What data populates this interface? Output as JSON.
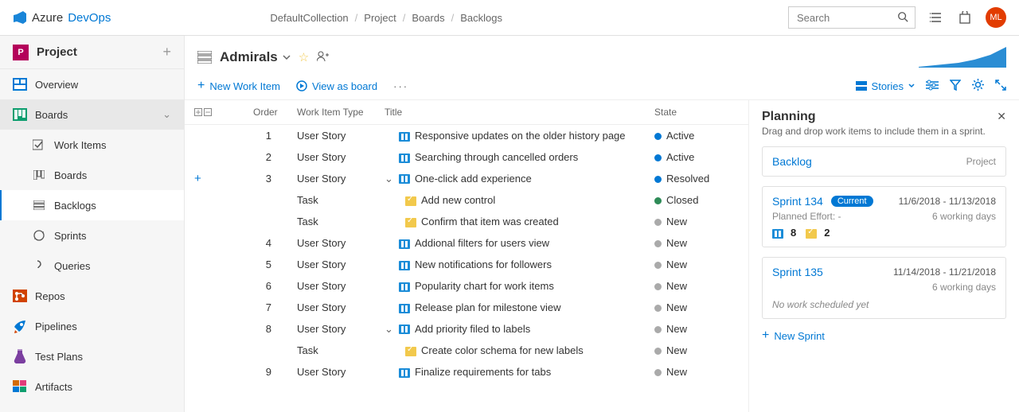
{
  "brand": {
    "azure": "Azure",
    "devops": "DevOps"
  },
  "breadcrumb": [
    "DefaultCollection",
    "Project",
    "Boards",
    "Backlogs"
  ],
  "search": {
    "placeholder": "Search"
  },
  "avatar": "ML",
  "project": {
    "initial": "P",
    "name": "Project"
  },
  "sidebar": [
    {
      "icon": "overview",
      "label": "Overview"
    },
    {
      "icon": "boards",
      "label": "Boards",
      "expanded": true,
      "children": [
        {
          "label": "Work Items"
        },
        {
          "label": "Boards"
        },
        {
          "label": "Backlogs",
          "active": true
        },
        {
          "label": "Sprints"
        },
        {
          "label": "Queries"
        }
      ]
    },
    {
      "icon": "repos",
      "label": "Repos"
    },
    {
      "icon": "pipelines",
      "label": "Pipelines"
    },
    {
      "icon": "testplans",
      "label": "Test Plans"
    },
    {
      "icon": "artifacts",
      "label": "Artifacts"
    }
  ],
  "team": {
    "icon": "backlog",
    "name": "Admirals"
  },
  "toolbar": {
    "newWorkItem": "New Work Item",
    "viewAsBoard": "View as board",
    "stories": "Stories"
  },
  "columns": {
    "order": "Order",
    "type": "Work Item Type",
    "title": "Title",
    "state": "State"
  },
  "rows": [
    {
      "order": "1",
      "type": "User Story",
      "icon": "story",
      "title": "Responsive updates on the older history page",
      "state": "Active",
      "stateClass": "active"
    },
    {
      "order": "2",
      "type": "User Story",
      "icon": "story",
      "title": "Searching through cancelled orders",
      "state": "Active",
      "stateClass": "active"
    },
    {
      "order": "3",
      "type": "User Story",
      "icon": "story",
      "title": "One-click add experience",
      "state": "Resolved",
      "stateClass": "resolved",
      "expander": "v",
      "addPlus": true
    },
    {
      "order": "",
      "type": "Task",
      "icon": "task",
      "title": "Add new control",
      "state": "Closed",
      "stateClass": "closed",
      "indent": 1
    },
    {
      "order": "",
      "type": "Task",
      "icon": "task",
      "title": "Confirm that item was created",
      "state": "New",
      "stateClass": "new",
      "indent": 1
    },
    {
      "order": "4",
      "type": "User Story",
      "icon": "story",
      "title": "Addional filters for users view",
      "state": "New",
      "stateClass": "new"
    },
    {
      "order": "5",
      "type": "User Story",
      "icon": "story",
      "title": "New notifications for followers",
      "state": "New",
      "stateClass": "new"
    },
    {
      "order": "6",
      "type": "User Story",
      "icon": "story",
      "title": "Popularity chart for work items",
      "state": "New",
      "stateClass": "new"
    },
    {
      "order": "7",
      "type": "User Story",
      "icon": "story",
      "title": "Release plan for milestone view",
      "state": "New",
      "stateClass": "new"
    },
    {
      "order": "8",
      "type": "User Story",
      "icon": "story",
      "title": "Add priority filed to labels",
      "state": "New",
      "stateClass": "new",
      "expander": "v"
    },
    {
      "order": "",
      "type": "Task",
      "icon": "task",
      "title": "Create color schema for new labels",
      "state": "New",
      "stateClass": "new",
      "indent": 1
    },
    {
      "order": "9",
      "type": "User Story",
      "icon": "story",
      "title": "Finalize requirements for tabs",
      "state": "New",
      "stateClass": "new"
    }
  ],
  "planning": {
    "heading": "Planning",
    "sub": "Drag and drop work items to include them in a sprint.",
    "backlog": {
      "label": "Backlog",
      "scope": "Project"
    },
    "sprints": [
      {
        "name": "Sprint 134",
        "badge": "Current",
        "dates": "11/6/2018 - 11/13/2018",
        "subLeft": "Planned Effort: -",
        "subRight": "6 working days",
        "counts": {
          "story": "8",
          "task": "2"
        }
      },
      {
        "name": "Sprint 135",
        "dates": "11/14/2018 - 11/21/2018",
        "subRight": "6 working days",
        "empty": "No work scheduled yet"
      }
    ],
    "newSprint": "New Sprint"
  },
  "chart_data": {
    "type": "area",
    "title": "",
    "x": [
      0,
      1,
      2,
      3,
      4,
      5,
      6,
      7,
      8,
      9
    ],
    "values": [
      2,
      3,
      4,
      5,
      6,
      8,
      10,
      14,
      20,
      26
    ],
    "ylim": [
      0,
      30
    ]
  }
}
